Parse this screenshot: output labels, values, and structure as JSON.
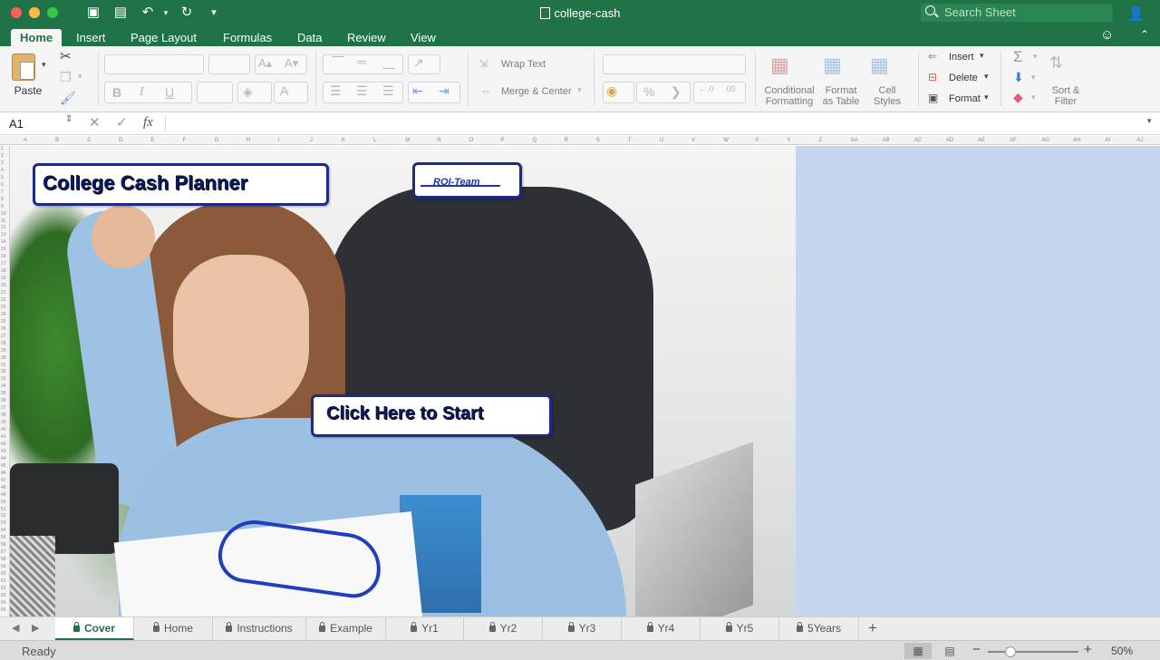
{
  "window": {
    "title": "college-cash",
    "search_placeholder": "Search Sheet"
  },
  "ribbon_tabs": [
    "Home",
    "Insert",
    "Page Layout",
    "Formulas",
    "Data",
    "Review",
    "View"
  ],
  "ribbon": {
    "paste": "Paste",
    "bold": "B",
    "italic": "I",
    "underline": "U",
    "wrap_text": "Wrap Text",
    "merge_center": "Merge & Center",
    "percent": "%",
    "conditional_formatting": [
      "Conditional",
      "Formatting"
    ],
    "format_as_table": [
      "Format",
      "as Table"
    ],
    "cell_styles": [
      "Cell",
      "Styles"
    ],
    "insert": "Insert",
    "delete": "Delete",
    "format": "Format",
    "sort_filter": [
      "Sort &",
      "Filter"
    ]
  },
  "formula_bar": {
    "name_box": "A1",
    "fx": "fx",
    "content": ""
  },
  "columns": [
    "A",
    "B",
    "C",
    "D",
    "E",
    "F",
    "G",
    "H",
    "I",
    "J",
    "K",
    "L",
    "M",
    "N",
    "O",
    "P",
    "Q",
    "R",
    "S",
    "T",
    "U",
    "V",
    "W",
    "X",
    "Y",
    "Z",
    "AA",
    "AB",
    "AC",
    "AD",
    "AE",
    "AF",
    "AG",
    "AH",
    "AI",
    "AJ"
  ],
  "rows": [
    "1",
    "2",
    "3",
    "4",
    "5",
    "6",
    "7",
    "8",
    "9",
    "10",
    "11",
    "12",
    "13",
    "14",
    "15",
    "16",
    "17",
    "18",
    "19",
    "20",
    "21",
    "22",
    "23",
    "24",
    "25",
    "26",
    "27",
    "28",
    "29",
    "30",
    "31",
    "32",
    "33",
    "34",
    "35",
    "36",
    "37",
    "38",
    "39",
    "40",
    "41",
    "42",
    "43",
    "44",
    "45",
    "46",
    "47",
    "48",
    "49",
    "50",
    "51",
    "52",
    "53",
    "54",
    "55",
    "56",
    "57",
    "58",
    "59",
    "60",
    "61",
    "62",
    "63",
    "64",
    "65"
  ],
  "sheet": {
    "title_shape": "College Cash Planner",
    "logo_text": "ROI-Team",
    "start_button": "Click Here to Start"
  },
  "sheet_tabs": [
    {
      "label": "Cover",
      "active": true
    },
    {
      "label": "Home",
      "active": false
    },
    {
      "label": "Instructions",
      "active": false
    },
    {
      "label": "Example",
      "active": false
    },
    {
      "label": "Yr1",
      "active": false
    },
    {
      "label": "Yr2",
      "active": false
    },
    {
      "label": "Yr3",
      "active": false
    },
    {
      "label": "Yr4",
      "active": false
    },
    {
      "label": "Yr5",
      "active": false
    },
    {
      "label": "5Years",
      "active": false
    }
  ],
  "status": {
    "text": "Ready",
    "zoom": "50%",
    "zoom_level": 0.25
  },
  "colors": {
    "excel_green": "#1f7346",
    "shape_border": "#1e2b86",
    "right_pane": "#c5d6ee"
  }
}
